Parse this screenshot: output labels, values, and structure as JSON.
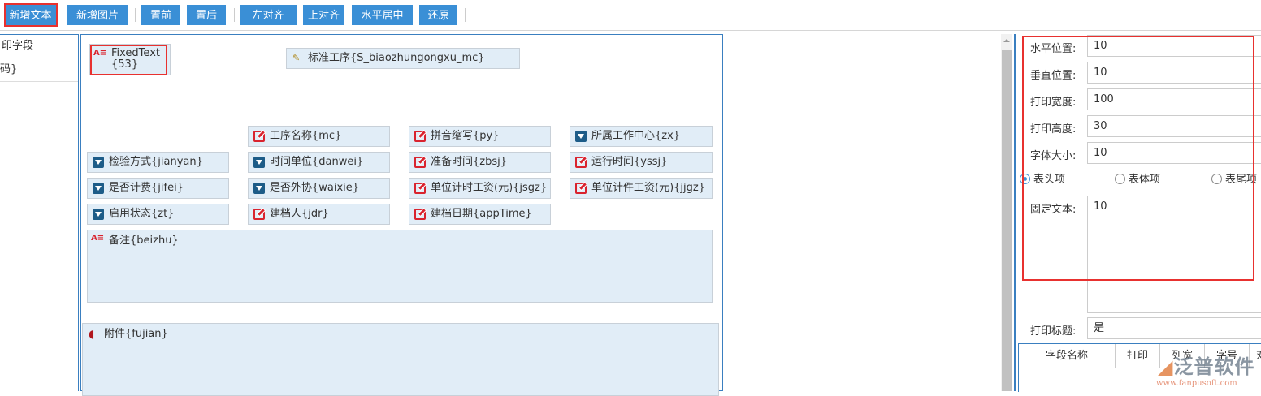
{
  "toolbar": {
    "add_text": "新增文本",
    "add_image": "新增图片",
    "bring_front": "置前",
    "send_back": "置后",
    "align_left": "左对齐",
    "align_top": "上对齐",
    "center_h": "水平居中",
    "restore": "还原"
  },
  "left_panel": {
    "items": [
      "印字段",
      "码}"
    ]
  },
  "canvas": {
    "fixed_text": "FixedText{53}",
    "standard_process": "标准工序{S_biaozhungongxu_mc}",
    "fields": [
      {
        "label": "工序名称{mc}",
        "icon": "edit-icon"
      },
      {
        "label": "拼音缩写{py}",
        "icon": "edit-icon"
      },
      {
        "label": "所属工作中心{zx}",
        "icon": "dropdown-icon"
      },
      {
        "label": "检验方式{jianyan}",
        "icon": "dropdown-icon"
      },
      {
        "label": "时间单位{danwei}",
        "icon": "dropdown-icon"
      },
      {
        "label": "准备时间{zbsj}",
        "icon": "edit-icon"
      },
      {
        "label": "运行时间{yssj}",
        "icon": "edit-icon"
      },
      {
        "label": "是否计费{jifei}",
        "icon": "dropdown-icon"
      },
      {
        "label": "是否外协{waixie}",
        "icon": "dropdown-icon"
      },
      {
        "label": "单位计时工资(元){jsgz}",
        "icon": "edit-icon"
      },
      {
        "label": "单位计件工资(元){jjgz}",
        "icon": "edit-icon"
      },
      {
        "label": "启用状态{zt}",
        "icon": "dropdown-icon"
      },
      {
        "label": "建档人{jdr}",
        "icon": "edit-icon"
      },
      {
        "label": "建档日期{appTime}",
        "icon": "edit-icon"
      }
    ],
    "remark": "备注{beizhu}",
    "attachment": "附件{fujian}"
  },
  "properties": {
    "x_label": "水平位置:",
    "x_value": "10",
    "y_label": "垂直位置:",
    "y_value": "10",
    "width_label": "打印宽度:",
    "width_value": "100",
    "height_label": "打印高度:",
    "height_value": "30",
    "font_label": "字体大小:",
    "font_value": "10",
    "radio_header": "表头项",
    "radio_body": "表体项",
    "radio_footer": "表尾项",
    "fixed_text_label": "固定文本:",
    "fixed_text_value": "10",
    "print_title_label": "打印标题:",
    "print_title_value": "是",
    "table_headers": [
      "字段名称",
      "打印",
      "列宽",
      "字号",
      "对"
    ]
  },
  "watermark": {
    "brand": "泛普软件",
    "url": "www.fanpusoft.com"
  }
}
